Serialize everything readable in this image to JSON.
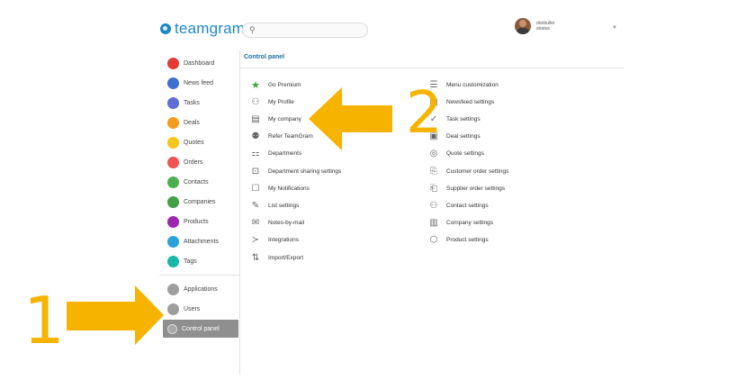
{
  "logo": {
    "text": "teamgram"
  },
  "search": {
    "icon": "search-icon"
  },
  "user": {
    "name_line1": "donbuller",
    "name_line2": "stratus"
  },
  "sidebar": {
    "items": [
      {
        "label": "Dashboard",
        "color": "#e53935"
      },
      {
        "label": "News feed",
        "color": "#3f6fd1"
      },
      {
        "label": "Tasks",
        "color": "#5e6ed6"
      },
      {
        "label": "Deals",
        "color": "#f39c1f"
      },
      {
        "label": "Quotes",
        "color": "#f5c518"
      },
      {
        "label": "Orders",
        "color": "#ef5350"
      },
      {
        "label": "Contacts",
        "color": "#4caf50"
      },
      {
        "label": "Companies",
        "color": "#43a047"
      },
      {
        "label": "Products",
        "color": "#9c27b0"
      },
      {
        "label": "Attachments",
        "color": "#29a3d8"
      },
      {
        "label": "Tags",
        "color": "#17b8a6"
      }
    ],
    "admin_items": [
      {
        "label": "Applications",
        "color": "#9e9e9e"
      },
      {
        "label": "Users",
        "color": "#9e9e9e"
      },
      {
        "label": "Control panel",
        "color": "#a8a8a8"
      }
    ]
  },
  "panel": {
    "title": "Control panel",
    "left_column": [
      {
        "label": "Go Premium",
        "icon": "star-icon",
        "glyph": "★"
      },
      {
        "label": "My Profile",
        "icon": "person-icon",
        "glyph": "⚇"
      },
      {
        "label": "My company",
        "icon": "building-icon",
        "glyph": "▤"
      },
      {
        "label": "Refer TeamGram",
        "icon": "refer-icon",
        "glyph": "⚉"
      },
      {
        "label": "Departments",
        "icon": "departments-icon",
        "glyph": "⚏"
      },
      {
        "label": "Department sharing settings",
        "icon": "lock-icon",
        "glyph": "⊡"
      },
      {
        "label": "My Notifications",
        "icon": "notification-icon",
        "glyph": "☐"
      },
      {
        "label": "List settings",
        "icon": "list-edit-icon",
        "glyph": "✎"
      },
      {
        "label": "Notes-by-mail",
        "icon": "mail-icon",
        "glyph": "✉"
      },
      {
        "label": "Integrations",
        "icon": "integrations-icon",
        "glyph": "≻"
      },
      {
        "label": "Import/Export",
        "icon": "import-export-icon",
        "glyph": "⇅"
      }
    ],
    "right_column": [
      {
        "label": "Menu customization",
        "icon": "menu-icon",
        "glyph": "☰"
      },
      {
        "label": "Newsfeed settings",
        "icon": "newsfeed-icon",
        "glyph": "▦"
      },
      {
        "label": "Task settings",
        "icon": "check-icon",
        "glyph": "✓"
      },
      {
        "label": "Deal settings",
        "icon": "deal-icon",
        "glyph": "▣"
      },
      {
        "label": "Quote settings",
        "icon": "quote-icon",
        "glyph": "◎"
      },
      {
        "label": "Customer order settings",
        "icon": "customer-order-icon",
        "glyph": "⎘"
      },
      {
        "label": "Supplier order settings",
        "icon": "supplier-order-icon",
        "glyph": "⎗"
      },
      {
        "label": "Contact settings",
        "icon": "contacts-icon",
        "glyph": "⚇"
      },
      {
        "label": "Company settings",
        "icon": "company-icon",
        "glyph": "▥"
      },
      {
        "label": "Product settings",
        "icon": "box-icon",
        "glyph": "⬡"
      }
    ]
  },
  "annotations": {
    "step1": "1",
    "step2": "2",
    "accent": "#f6b400"
  }
}
